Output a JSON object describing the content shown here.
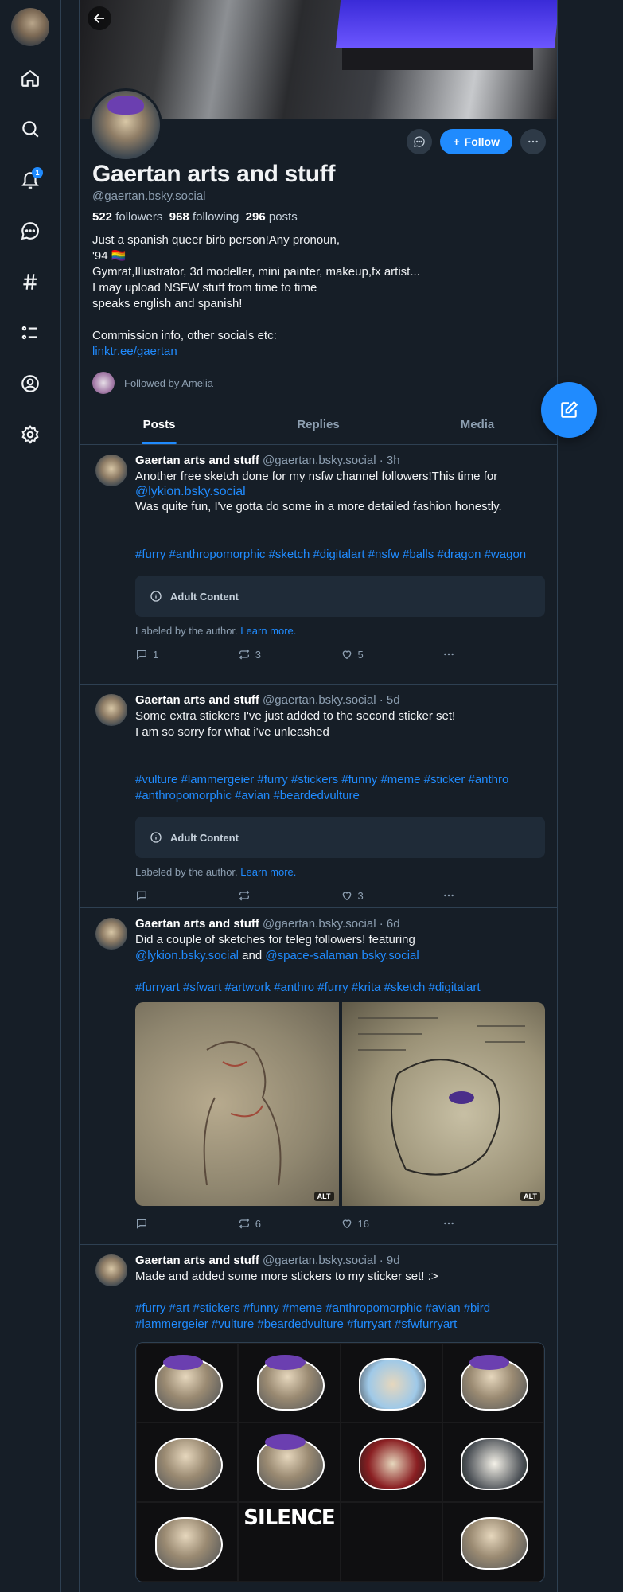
{
  "rail": {
    "notification_count": "1",
    "items": [
      "home",
      "search",
      "notifications",
      "chat",
      "feeds",
      "lists",
      "profile",
      "settings"
    ]
  },
  "profile": {
    "name": "Gaertan arts and stuff",
    "handle": "@gaertan.bsky.social",
    "followers_count": "522",
    "followers_label": "followers",
    "following_count": "968",
    "following_label": "following",
    "posts_count": "296",
    "posts_label": "posts",
    "follow_label": "Follow",
    "bio": "Just a spanish queer birb person!Any pronoun,\n'94 🏳️‍🌈\nGymrat,Illustrator, 3d modeller, mini painter, makeup,fx artist...\nI may upload NSFW stuff from time to time\nspeaks english and spanish!\n\nCommission info, other socials etc:",
    "link": "linktr.ee/gaertan",
    "followed_by": "Followed by Amelia"
  },
  "tabs": [
    "Posts",
    "Replies",
    "Media"
  ],
  "posts": [
    {
      "author": "Gaertan arts and stuff",
      "meta": "@gaertan.bsky.social · 3h",
      "text1": "Another free sketch done for my nsfw channel followers!This time for",
      "mention1": "@lykion.bsky.social",
      "text2": "Was quite fun, I've gotta do some in a more detailed fashion honestly.",
      "tags": "#furry #anthropomorphic #sketch #digitalart #nsfw #balls #dragon #wagon",
      "adult": "Adult Content",
      "labeled": "Labeled by the author.",
      "learn": "Learn more.",
      "replies": "1",
      "reposts": "3",
      "likes": "5"
    },
    {
      "author": "Gaertan arts and stuff",
      "meta": "@gaertan.bsky.social · 5d",
      "text1": "Some extra stickers I've just added to the second sticker set!\nI am so sorry for what i've unleashed",
      "tags": "#vulture #lammergeier #furry #stickers #funny #meme #sticker #anthro #anthropomorphic #avian #beardedvulture",
      "adult": "Adult Content",
      "labeled": "Labeled by the author.",
      "learn": "Learn more.",
      "replies": "",
      "reposts": "",
      "likes": "3"
    },
    {
      "author": "Gaertan arts and stuff",
      "meta": "@gaertan.bsky.social · 6d",
      "text1": "Did a couple of sketches for teleg followers! featuring",
      "mention1": "@lykion.bsky.social",
      "and": "and",
      "mention2": "@space-salaman.bsky.social",
      "tags": "#furryart #sfwart #artwork #anthro #furry #krita #sketch #digitalart",
      "alt": "ALT",
      "replies": "",
      "reposts": "6",
      "likes": "16"
    },
    {
      "author": "Gaertan arts and stuff",
      "meta": "@gaertan.bsky.social · 9d",
      "text1": "Made and added some more stickers to my sticker set! :>",
      "tags": "#furry #art #stickers #funny #meme #anthropomorphic #avian #bird #lammergeier #vulture #beardedvulture #furryart #sfwfurryart",
      "sticker_text_1": "SILENCE"
    }
  ],
  "colors": {
    "accent": "#208bfe",
    "background": "#161e27",
    "border": "#2e4052",
    "muted": "#8d9fb1"
  }
}
